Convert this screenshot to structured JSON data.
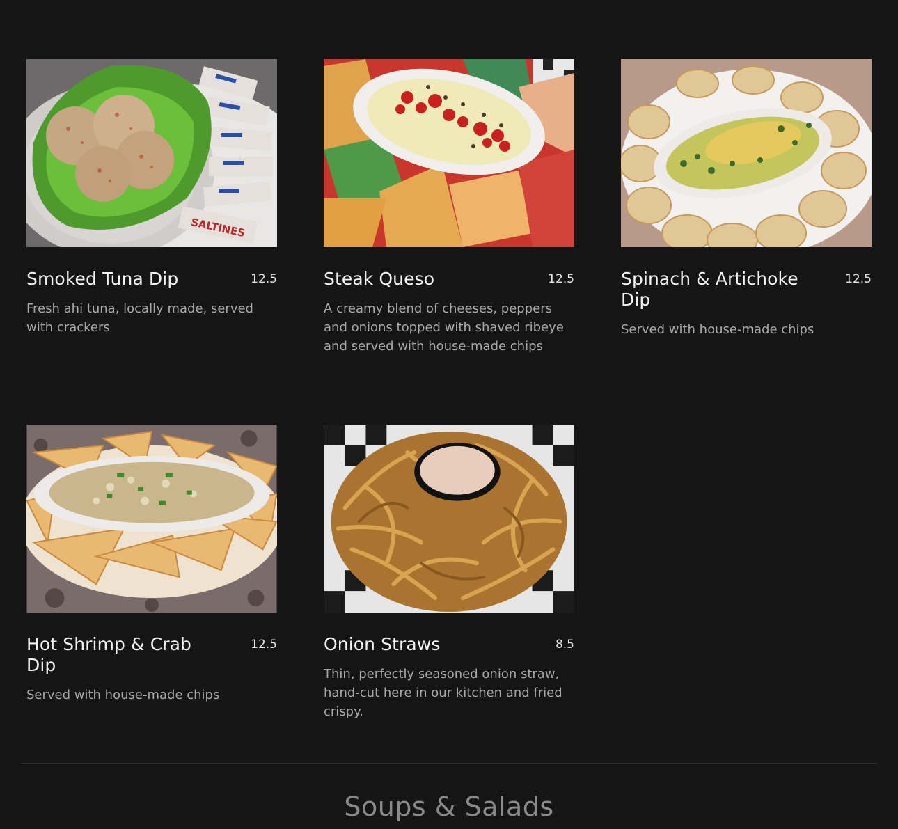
{
  "items": [
    {
      "name": "Smoked Tuna Dip",
      "price": "12.5",
      "description": "Fresh ahi tuna, locally made, served with crackers",
      "image": "smoked-tuna-dip-photo"
    },
    {
      "name": "Steak Queso",
      "price": "12.5",
      "description": "A creamy blend of cheeses, peppers and onions topped with shaved ribeye and served with house-made chips",
      "image": "steak-queso-photo"
    },
    {
      "name": "Spinach & Artichoke Dip",
      "price": "12.5",
      "description": "Served with house-made chips",
      "image": "spinach-artichoke-dip-photo"
    },
    {
      "name": "Hot Shrimp & Crab Dip",
      "price": "12.5",
      "description": "Served with house-made chips",
      "image": "hot-shrimp-crab-dip-photo"
    },
    {
      "name": "Onion Straws",
      "price": "8.5",
      "description": "Thin, perfectly seasoned onion straw, hand-cut here in our kitchen and fried crispy.",
      "image": "onion-straws-photo"
    }
  ],
  "next_section": {
    "title": "Soups & Salads"
  },
  "colors": {
    "background": "#151515",
    "title_text": "#f2f2f2",
    "description_text": "#a9a9a9",
    "section_title_text": "#8a8a8a"
  }
}
